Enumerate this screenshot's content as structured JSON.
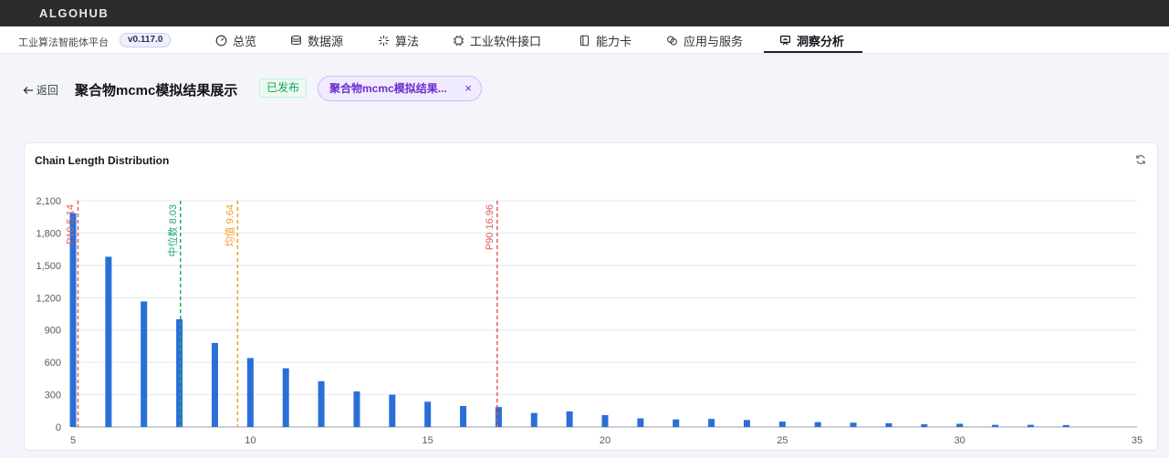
{
  "brand": "ALGOHUB",
  "nav": {
    "platform": "工业算法智能体平台",
    "version": "v0.117.0",
    "items": [
      {
        "label": "总览",
        "icon": "dashboard-icon"
      },
      {
        "label": "数据源",
        "icon": "database-icon"
      },
      {
        "label": "算法",
        "icon": "sparkle-icon"
      },
      {
        "label": "工业软件接口",
        "icon": "chip-icon"
      },
      {
        "label": "能力卡",
        "icon": "card-icon"
      },
      {
        "label": "应用与服务",
        "icon": "link-icon"
      },
      {
        "label": "洞察分析",
        "icon": "presentation-icon",
        "active": true
      }
    ]
  },
  "header": {
    "back_label": "返回",
    "title": "聚合物mcmc模拟结果展示",
    "status": "已发布",
    "tag": "聚合物mcmc模拟结果...",
    "tag_close": "×"
  },
  "card": {
    "title": "Chain Length Distribution"
  },
  "colors": {
    "bar": "#2a6fd6",
    "p10": "#e05a5a",
    "median": "#21a87a",
    "mean": "#f0a020",
    "p90": "#e05a5a"
  },
  "chart_data": {
    "type": "bar",
    "x": [
      5,
      6,
      7,
      8,
      9,
      10,
      11,
      12,
      13,
      14,
      15,
      16,
      17,
      18,
      19,
      20,
      21,
      22,
      23,
      24,
      25,
      26,
      27,
      28,
      29,
      30,
      31,
      32,
      33
    ],
    "values": [
      1985,
      1580,
      1165,
      1000,
      780,
      640,
      545,
      425,
      330,
      300,
      235,
      195,
      185,
      130,
      145,
      110,
      80,
      70,
      75,
      65,
      50,
      45,
      40,
      35,
      25,
      30,
      20,
      20,
      18
    ],
    "xlim": [
      5,
      35
    ],
    "ylim": [
      0,
      2100
    ],
    "xticks": [
      "5",
      "10",
      "15",
      "20",
      "25",
      "30",
      "35"
    ],
    "yticks": [
      "0",
      "300",
      "600",
      "900",
      "1,200",
      "1,500",
      "1,800",
      "2,100"
    ],
    "grid": true,
    "reference_lines": [
      {
        "label": "P10 5.14",
        "value": 5.14,
        "color": "#e05a5a"
      },
      {
        "label": "中位数 8.03",
        "value": 8.03,
        "color": "#21a87a"
      },
      {
        "label": "均值 9.64",
        "value": 9.64,
        "color": "#f0a020"
      },
      {
        "label": "P90 16.96",
        "value": 16.96,
        "color": "#e05a5a"
      }
    ]
  }
}
